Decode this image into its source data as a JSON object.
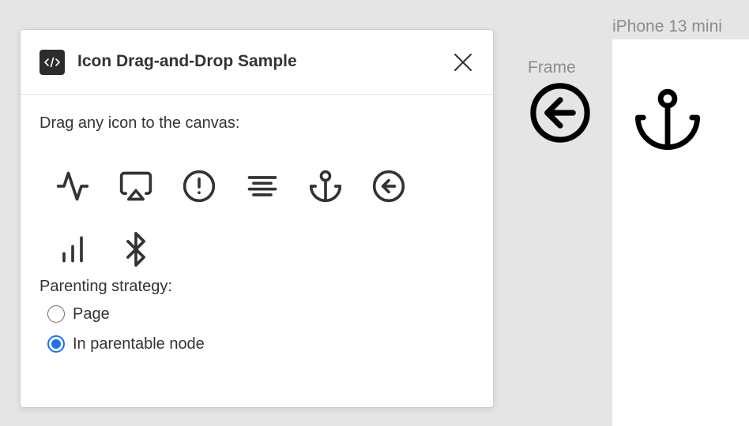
{
  "canvas": {
    "frame_label": "Frame",
    "device_label": "iPhone 13 mini",
    "frame_icon": "arrow-left-circle-icon",
    "device_icon": "anchor-icon"
  },
  "dialog": {
    "title": "Icon Drag-and-Drop Sample",
    "plugin_icon": "code-icon",
    "close_icon": "close-icon",
    "instructions": "Drag any icon to the canvas:",
    "icons": [
      {
        "name": "activity-icon"
      },
      {
        "name": "airplay-icon"
      },
      {
        "name": "alert-circle-icon"
      },
      {
        "name": "align-center-icon"
      },
      {
        "name": "anchor-icon"
      },
      {
        "name": "arrow-left-circle-icon"
      },
      {
        "name": "bar-chart-icon"
      },
      {
        "name": "bluetooth-icon"
      }
    ],
    "parenting": {
      "label": "Parenting strategy:",
      "options": [
        {
          "label": "Page",
          "checked": false
        },
        {
          "label": "In parentable node",
          "checked": true
        }
      ]
    }
  },
  "colors": {
    "accent": "#1a73e8",
    "canvas_bg": "#e5e5e5",
    "text": "#333333"
  }
}
